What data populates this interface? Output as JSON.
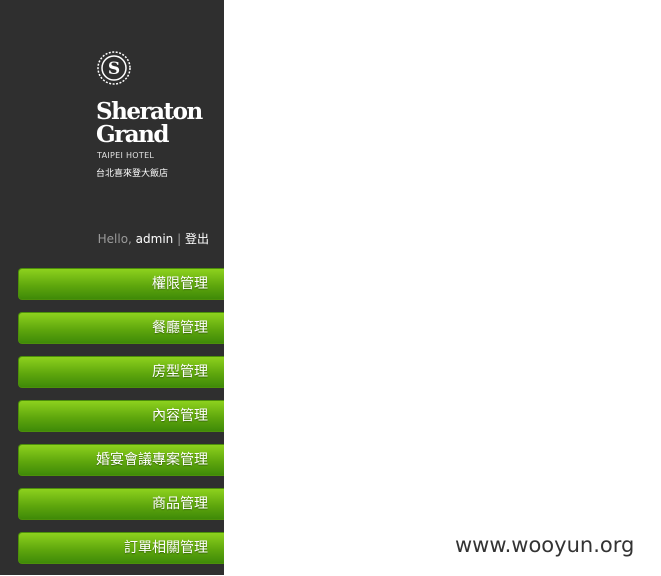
{
  "brand": {
    "line1": "Sheraton",
    "line2": "Grand",
    "hotel_en": "TAIPEI HOTEL",
    "hotel_zh": "台北喜來登大飯店",
    "emblem_letter": "S"
  },
  "user": {
    "greeting": "Hello, ",
    "name": "admin",
    "separator": "|",
    "logout_label": "登出"
  },
  "menu": [
    {
      "label": "權限管理"
    },
    {
      "label": "餐廳管理"
    },
    {
      "label": "房型管理"
    },
    {
      "label": "內容管理"
    },
    {
      "label": "婚宴會議專案管理"
    },
    {
      "label": "商品管理"
    },
    {
      "label": "訂單相關管理"
    }
  ],
  "watermark": "www.wooyun.org",
  "colors": {
    "sidebar_bg": "#2f2f2f",
    "menu_green": "#6ab613",
    "content_bg": "#ffffff"
  }
}
